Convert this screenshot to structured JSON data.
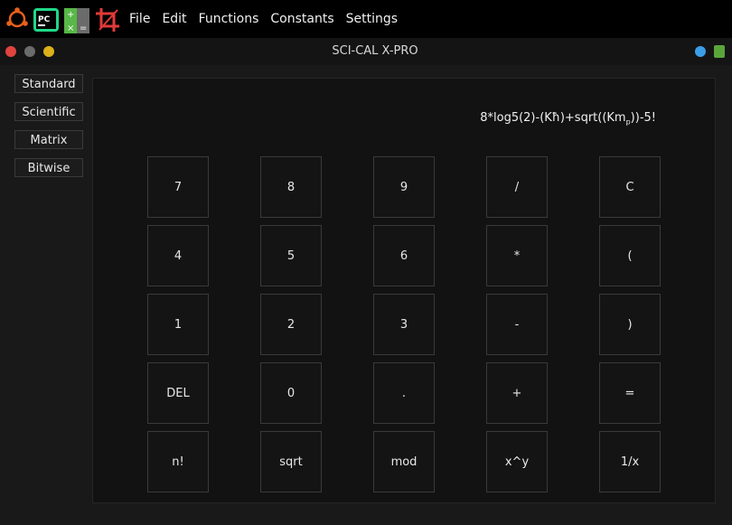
{
  "menu": [
    "File",
    "Edit",
    "Functions",
    "Constants",
    "Settings"
  ],
  "window": {
    "title": "SCI-CAL X-PRO"
  },
  "modes": [
    "Standard",
    "Scientific",
    "Matrix",
    "Bitwise"
  ],
  "display": {
    "expression_main": "8*log5(2)-(Kħ)+sqrt((Km",
    "expression_sub": "p",
    "expression_tail": "))-5!"
  },
  "keys": [
    [
      "7",
      "8",
      "9",
      "/",
      "C"
    ],
    [
      "4",
      "5",
      "6",
      "*",
      "("
    ],
    [
      "1",
      "2",
      "3",
      "-",
      ")"
    ],
    [
      "DEL",
      "0",
      ".",
      "+",
      "="
    ],
    [
      "n!",
      "sqrt",
      "mod",
      "x^y",
      "1/x"
    ]
  ],
  "colors": {
    "accent_red": "#e0443e",
    "accent_grey": "#6b6b6b",
    "accent_yellow": "#dcb11a",
    "status_blue": "#3a9ee8",
    "status_green": "#5aa53a"
  }
}
